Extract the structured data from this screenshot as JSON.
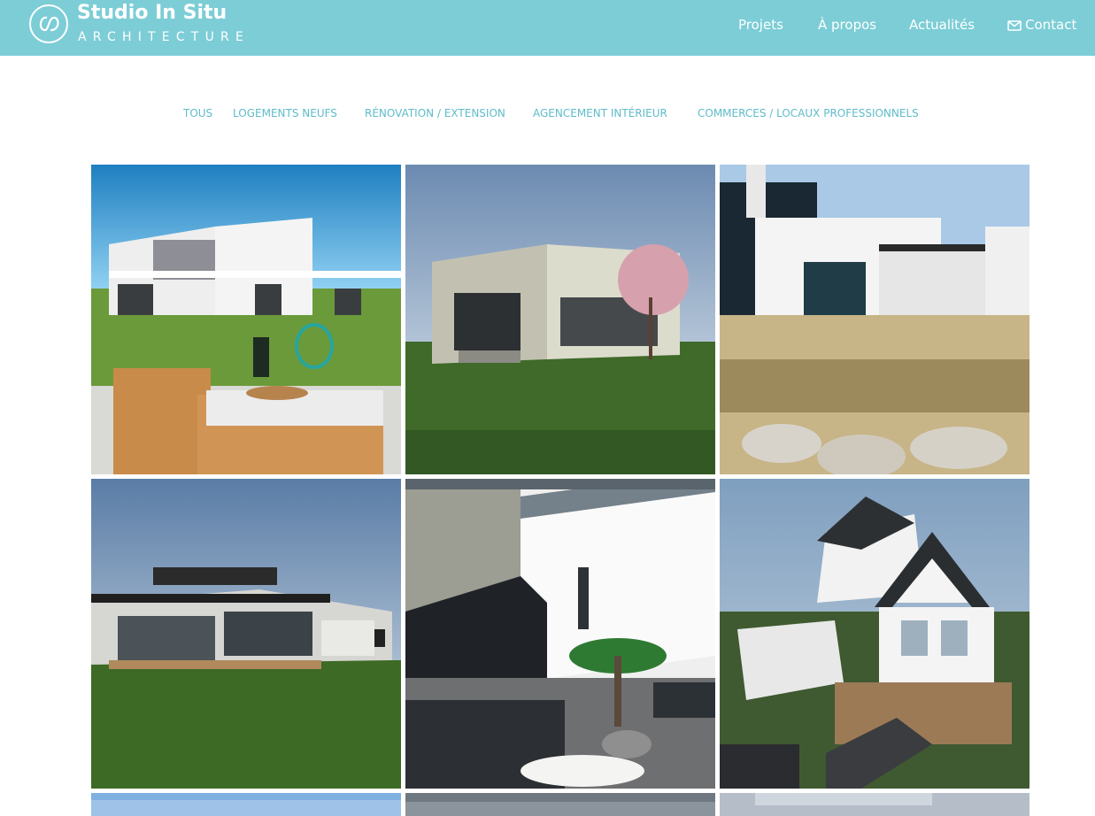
{
  "brand": {
    "name": "Studio In Situ",
    "tagline": "ARCHITECTURE"
  },
  "nav": {
    "items": [
      {
        "label": "Projets"
      },
      {
        "label": "À propos"
      },
      {
        "label": "Actualités"
      },
      {
        "label": "Contact",
        "icon": "envelope-icon"
      }
    ]
  },
  "filters": {
    "items": [
      {
        "label": "TOUS"
      },
      {
        "label": "LOGEMENTS NEUFS"
      },
      {
        "label": "RÉNOVATION / EXTENSION"
      },
      {
        "label": "AGENCEMENT INTÉRIEUR"
      },
      {
        "label": "COMMERCES / LOCAUX PROFESSIONNELS"
      }
    ]
  },
  "colors": {
    "header_bg": "#7ccdd6",
    "filter_text": "#5fbcc9",
    "nav_text": "#ffffff"
  }
}
